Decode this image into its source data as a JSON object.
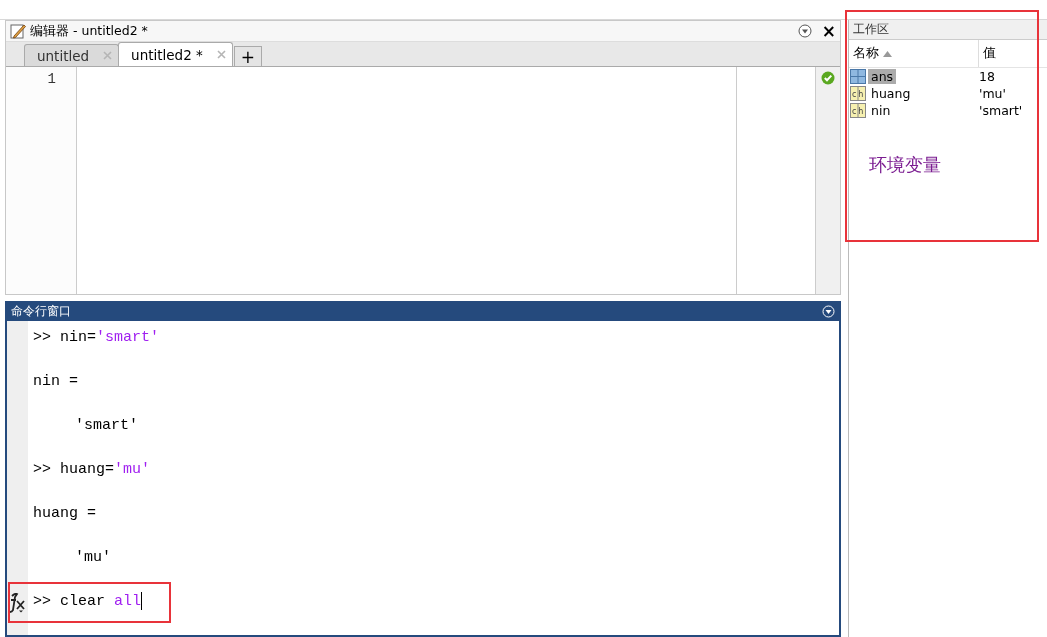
{
  "editor": {
    "title": "编辑器 - untitled2 *",
    "tabs": [
      {
        "label": "untitled",
        "selected": false
      },
      {
        "label": "untitled2 *",
        "selected": true
      }
    ],
    "add_tab": "+",
    "close": "×",
    "line_numbers": [
      "1"
    ],
    "check_passed": true
  },
  "command_window": {
    "title": "命令行窗口",
    "lines": [
      {
        "kind": "input",
        "segments": [
          {
            "text": ">> nin=",
            "kind": "plain"
          },
          {
            "text": "'smart'",
            "kind": "string"
          }
        ]
      },
      {
        "kind": "output",
        "segments": [
          {
            "text": "nin =",
            "kind": "plain"
          }
        ]
      },
      {
        "kind": "value",
        "segments": [
          {
            "text": "'smart'",
            "kind": "plain"
          }
        ]
      },
      {
        "kind": "input",
        "segments": [
          {
            "text": ">> huang=",
            "kind": "plain"
          },
          {
            "text": "'mu'",
            "kind": "string"
          }
        ]
      },
      {
        "kind": "output",
        "segments": [
          {
            "text": "huang =",
            "kind": "plain"
          }
        ]
      },
      {
        "kind": "value",
        "segments": [
          {
            "text": "'mu'",
            "kind": "plain"
          }
        ]
      },
      {
        "kind": "prompt",
        "annotated": true,
        "segments": [
          {
            "text": ">> clear ",
            "kind": "plain"
          },
          {
            "text": "all",
            "kind": "string"
          }
        ]
      }
    ]
  },
  "workspace": {
    "title": "工作区",
    "annotated": true,
    "annotation": "环境变量",
    "columns": [
      {
        "label": "名称",
        "sorted": true
      },
      {
        "label": "值",
        "sorted": false
      }
    ],
    "rows": [
      {
        "name": "ans",
        "value": "18",
        "kind": "matrix",
        "selected": true
      },
      {
        "name": "huang",
        "value": "'mu'",
        "kind": "char",
        "icon": "ch",
        "selected": false
      },
      {
        "name": "nin",
        "value": "'smart'",
        "kind": "char",
        "icon": "ch",
        "selected": false
      }
    ]
  }
}
